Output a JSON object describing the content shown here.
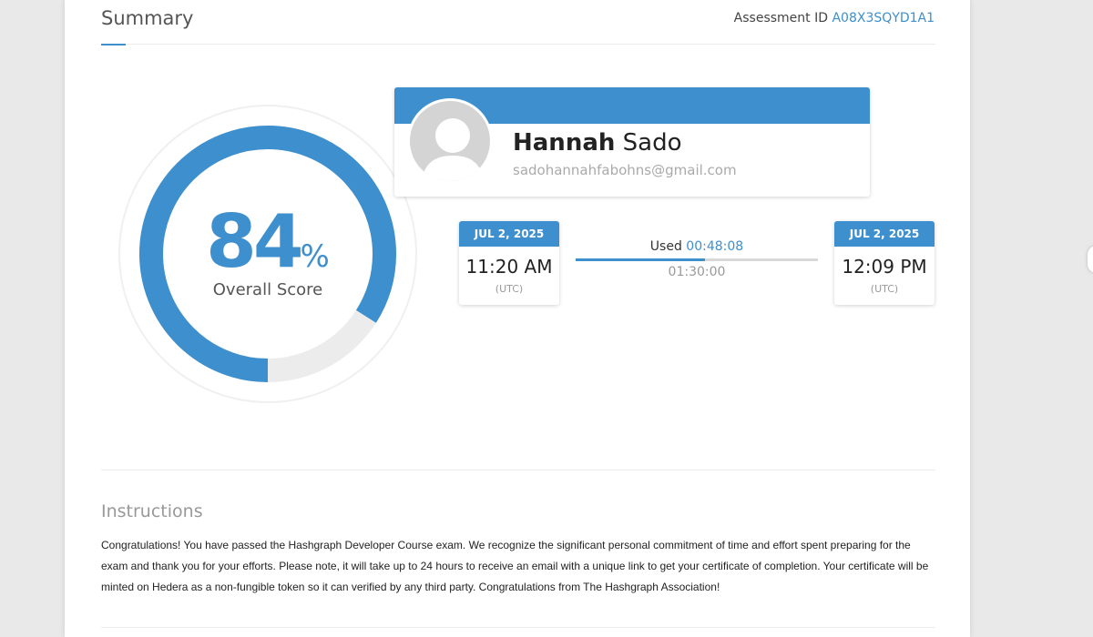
{
  "header": {
    "title": "Summary",
    "assessment_label": "Assessment ID",
    "assessment_id": "A08X3SQYD1A1"
  },
  "score": {
    "value": "84",
    "unit": "%",
    "fraction": 0.84,
    "label": "Overall Score"
  },
  "profile": {
    "first_name": "Hannah",
    "last_name": "Sado",
    "email": "sadohannahfabohns@gmail.com"
  },
  "session": {
    "start": {
      "date": "JUL 2, 2025",
      "time": "11:20 AM",
      "tz": "(UTC)"
    },
    "end": {
      "date": "JUL 2, 2025",
      "time": "12:09 PM",
      "tz": "(UTC)"
    },
    "used_label": "Used",
    "used_value": "00:48:08",
    "duration": "01:30:00",
    "used_fraction": 0.535
  },
  "instructions": {
    "title": "Instructions",
    "body": "Congratulations! You have passed the Hashgraph Developer Course exam. We recognize the significant personal commitment of time and effort spent preparing for the exam and thank you for your efforts. Please note, it will take up to 24 hours to receive an email with a unique link to get your certificate of completion. Your certificate will be minted on Hedera as a non-fungible token so it can verified by any third party. Congratulations from The Hashgraph Association!"
  },
  "colors": {
    "accent": "#3d8fce",
    "track": "#ececec"
  },
  "icons": {
    "avatar": "user-avatar-icon"
  }
}
